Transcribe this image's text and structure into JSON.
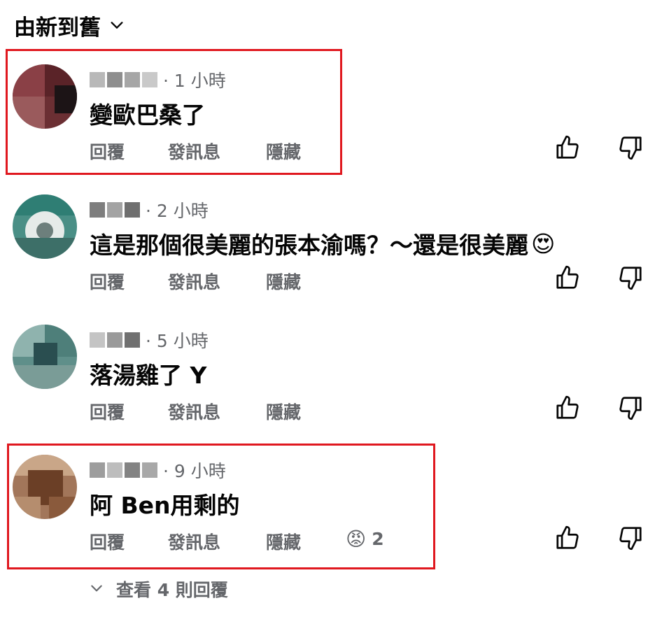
{
  "sort": {
    "label": "由新到舊",
    "icon": "chevron-down-icon"
  },
  "actions": {
    "reply": "回覆",
    "message": "發訊息",
    "hide": "隱藏"
  },
  "icons": {
    "like": "thumbs-up-icon",
    "dislike": "thumbs-down-icon"
  },
  "comments": [
    {
      "time": "· 1 小時",
      "text": "變歐巴桑了",
      "highlighted": true
    },
    {
      "time": "· 2 小時",
      "text": "這是那個很美麗的張本渝嗎？～還是很美麗",
      "emoji": "😍",
      "highlighted": false
    },
    {
      "time": "· 5 小時",
      "text": "落湯雞了 Y",
      "highlighted": false
    },
    {
      "time": "· 9 小時",
      "text": "阿 Ben用剩的",
      "highlighted": true,
      "reaction": {
        "emoji": "😡",
        "count": "2"
      }
    }
  ],
  "more_replies": "查看 4 則回覆",
  "colors": {
    "highlight": "#e0181f",
    "secondary_text": "#65676b",
    "primary_text": "#050505"
  }
}
